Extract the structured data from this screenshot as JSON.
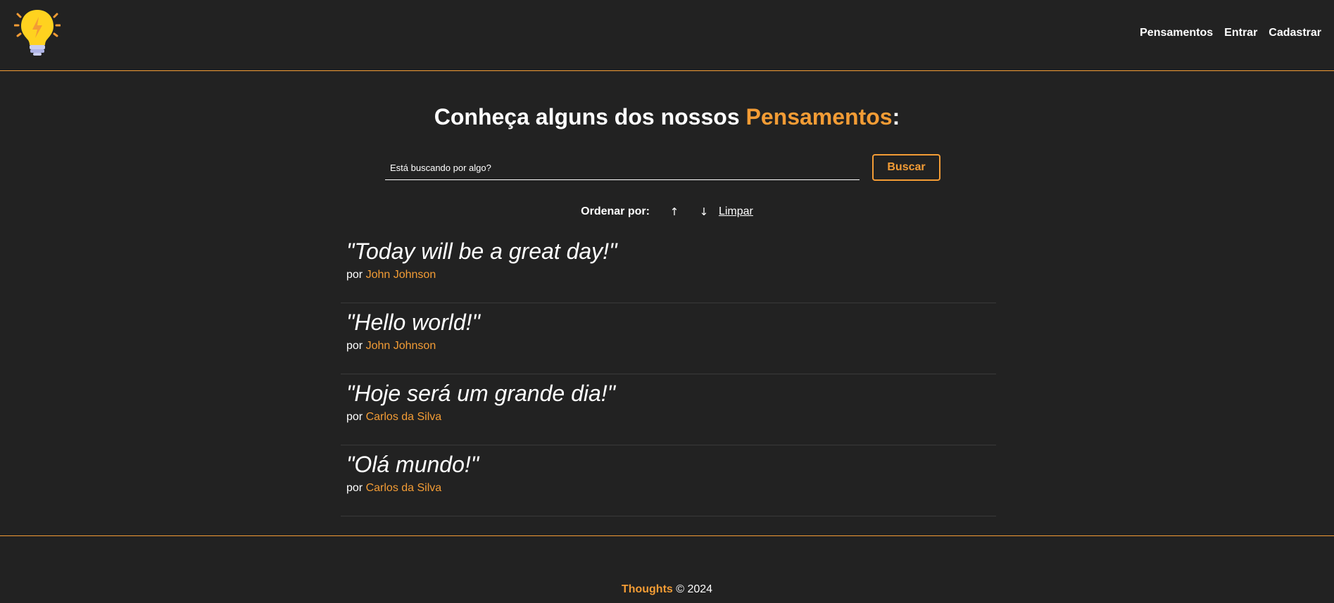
{
  "nav": {
    "items": [
      "Pensamentos",
      "Entrar",
      "Cadastrar"
    ]
  },
  "main": {
    "title_prefix": "Conheça alguns dos nossos ",
    "title_accent": "Pensamentos",
    "title_suffix": ":",
    "search": {
      "placeholder": "Está buscando por algo?",
      "button_label": "Buscar"
    },
    "order": {
      "label": "Ordenar por:",
      "asc_symbol": "↑",
      "desc_symbol": "↓",
      "clear_label": "Limpar"
    }
  },
  "thoughts": [
    {
      "text": "\"Today will be a great day!\"",
      "by": "por",
      "author": "John Johnson"
    },
    {
      "text": "\"Hello world!\"",
      "by": "por",
      "author": "John Johnson"
    },
    {
      "text": "\"Hoje será um grande dia!\"",
      "by": "por",
      "author": "Carlos da Silva"
    },
    {
      "text": "\"Olá mundo!\"",
      "by": "por",
      "author": "Carlos da Silva"
    }
  ],
  "footer": {
    "brand": "Thoughts",
    "copyright": " © 2024"
  },
  "colors": {
    "accent": "#f39c35",
    "background": "#222222",
    "text": "#ffffff"
  },
  "icons": {
    "logo": "lightbulb-icon"
  }
}
